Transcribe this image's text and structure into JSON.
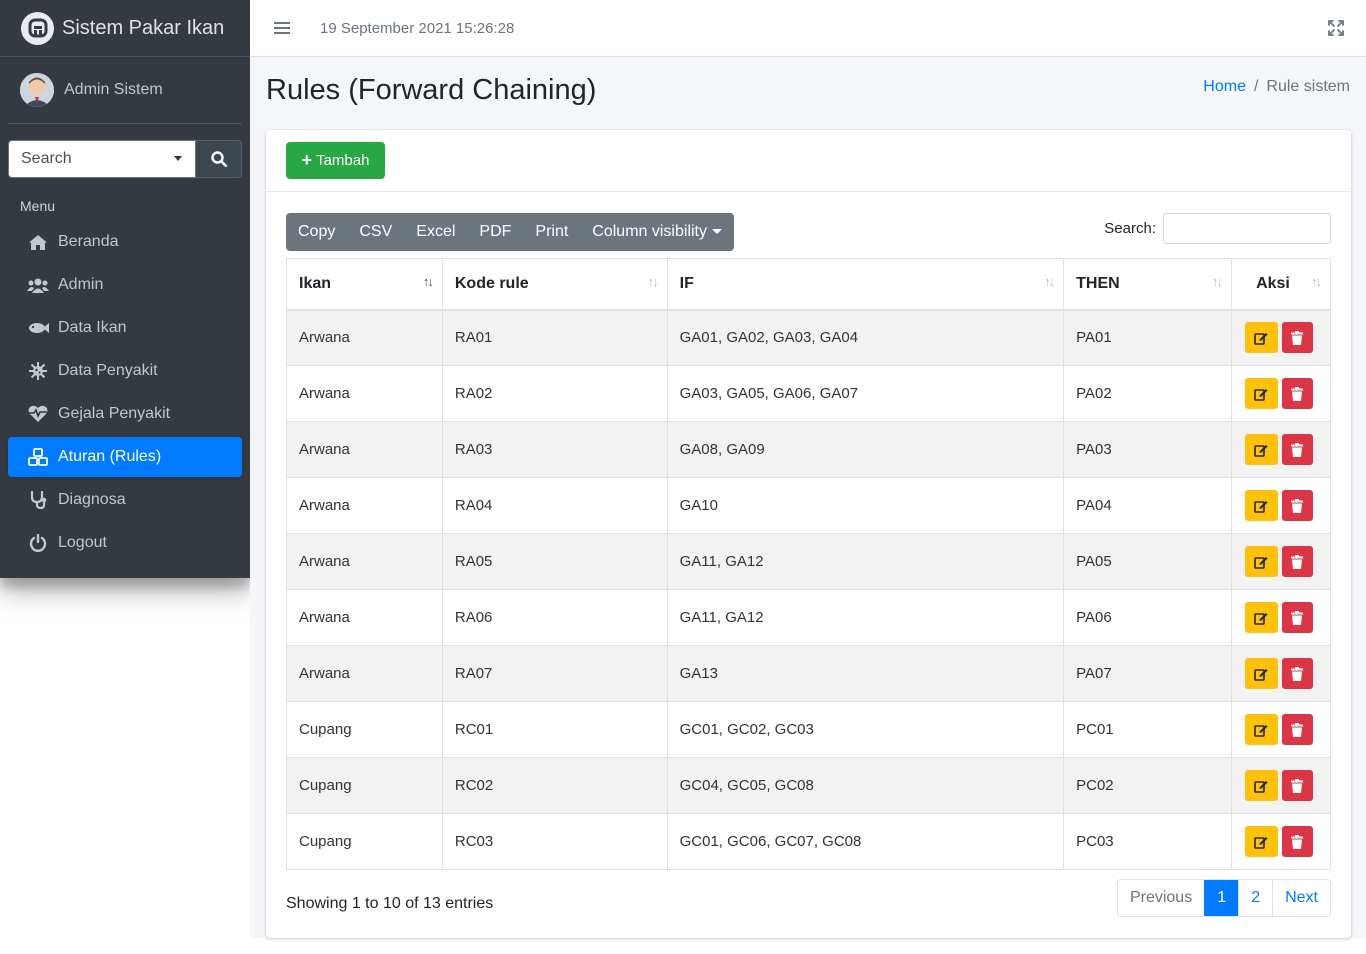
{
  "brand": {
    "title": "Sistem Pakar Ikan"
  },
  "user": {
    "name": "Admin Sistem"
  },
  "sidebar": {
    "search_placeholder": "Search",
    "menu_header": "Menu",
    "items": [
      {
        "label": "Beranda",
        "icon": "home-icon"
      },
      {
        "label": "Admin",
        "icon": "users-icon"
      },
      {
        "label": "Data Ikan",
        "icon": "fish-icon"
      },
      {
        "label": "Data Penyakit",
        "icon": "virus-icon"
      },
      {
        "label": "Gejala Penyakit",
        "icon": "heartbeat-icon"
      },
      {
        "label": "Aturan (Rules)",
        "icon": "cubes-icon",
        "active": true
      },
      {
        "label": "Diagnosa",
        "icon": "stethoscope-icon"
      },
      {
        "label": "Logout",
        "icon": "power-icon"
      }
    ]
  },
  "topbar": {
    "datetime": "19 September 2021 15:26:28"
  },
  "page": {
    "title": "Rules (Forward Chaining)",
    "breadcrumb": {
      "home": "Home",
      "separator": "/",
      "current": "Rule sistem"
    }
  },
  "card": {
    "add_label": "Tambah",
    "export_buttons": [
      "Copy",
      "CSV",
      "Excel",
      "PDF",
      "Print",
      "Column visibility"
    ],
    "search_label": "Search:",
    "columns": [
      "Ikan",
      "Kode rule",
      "IF",
      "THEN",
      "Aksi"
    ],
    "rows": [
      [
        "Arwana",
        "RA01",
        "GA01, GA02, GA03, GA04",
        "PA01"
      ],
      [
        "Arwana",
        "RA02",
        "GA03, GA05, GA06, GA07",
        "PA02"
      ],
      [
        "Arwana",
        "RA03",
        "GA08, GA09",
        "PA03"
      ],
      [
        "Arwana",
        "RA04",
        "GA10",
        "PA04"
      ],
      [
        "Arwana",
        "RA05",
        "GA11, GA12",
        "PA05"
      ],
      [
        "Arwana",
        "RA06",
        "GA11, GA12",
        "PA06"
      ],
      [
        "Arwana",
        "RA07",
        "GA13",
        "PA07"
      ],
      [
        "Cupang",
        "RC01",
        "GC01, GC02, GC03",
        "PC01"
      ],
      [
        "Cupang",
        "RC02",
        "GC04, GC05, GC08",
        "PC02"
      ],
      [
        "Cupang",
        "RC03",
        "GC01, GC06, GC07, GC08",
        "PC03"
      ]
    ],
    "info": "Showing 1 to 10 of 13 entries",
    "pagination": {
      "previous": "Previous",
      "pages": [
        "1",
        "2"
      ],
      "current": "1",
      "next": "Next"
    }
  },
  "colors": {
    "sidebar_bg": "#343a40",
    "active": "#007bff",
    "success": "#28a745",
    "warning": "#ffc107",
    "danger": "#dc3545"
  }
}
